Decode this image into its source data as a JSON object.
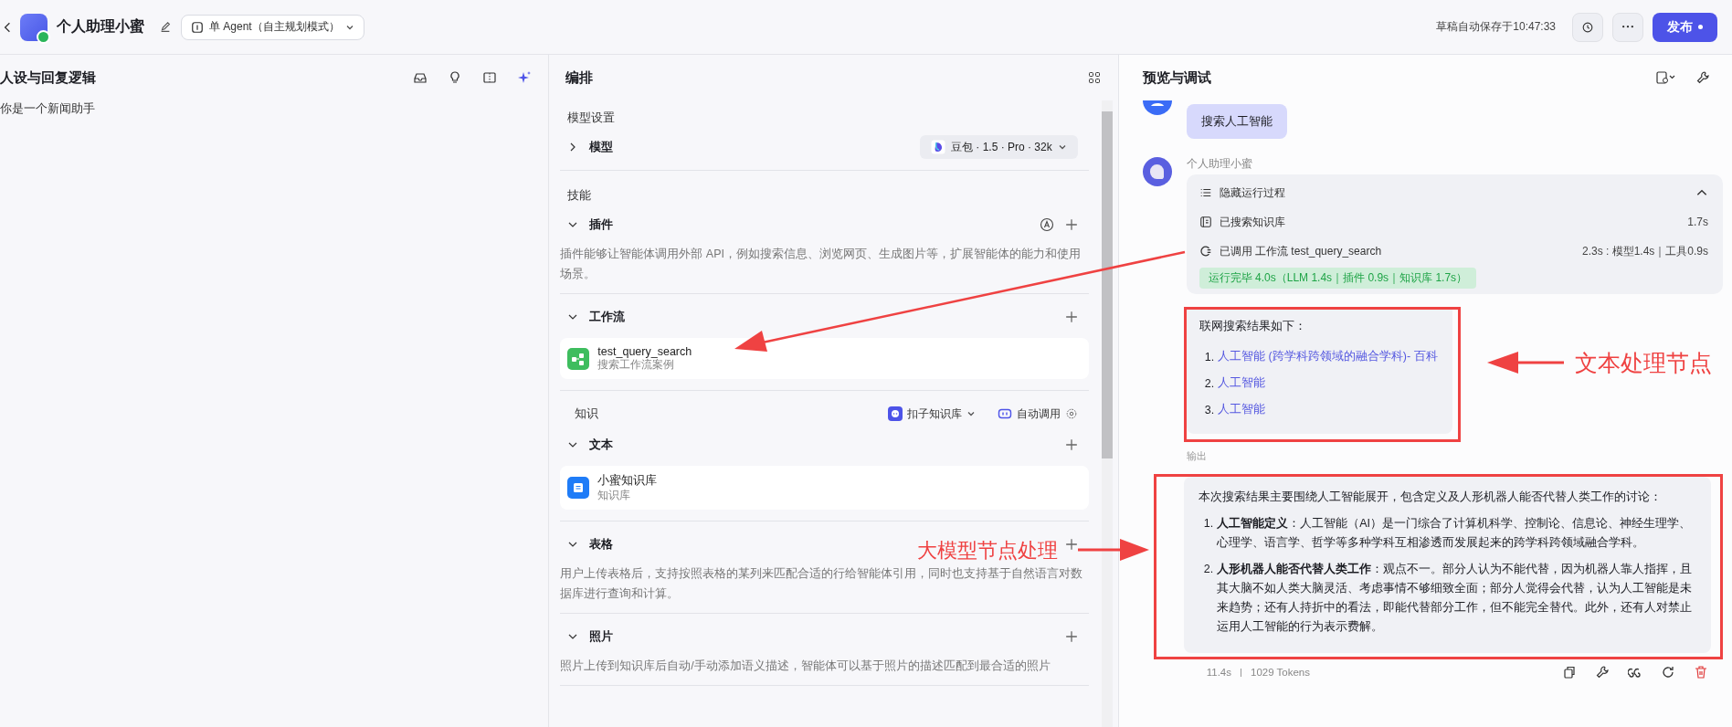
{
  "header": {
    "agent_name": "个人助理小蜜",
    "mode": "单 Agent（自主规划模式）",
    "autosave": "草稿自动保存于10:47:33",
    "publish": "发布"
  },
  "persona": {
    "title": "人设与回复逻辑",
    "prompt": "你是一个新闻助手"
  },
  "arrange": {
    "title": "编排",
    "model_settings": {
      "heading": "模型设置",
      "label": "模型",
      "expanded": false,
      "model": "豆包 · 1.5 · Pro · 32k"
    },
    "skills": {
      "heading": "技能",
      "items": [
        {
          "kind": "plugin",
          "label": "插件",
          "expanded": true,
          "description": "插件能够让智能体调用外部 API，例如搜索信息、浏览网页、生成图片等，扩展智能体的能力和使用场景。"
        },
        {
          "kind": "workflow",
          "label": "工作流",
          "expanded": true,
          "cards": [
            {
              "kind": "workflow",
              "title": "test_query_search",
              "subtitle": "搜索工作流案例"
            }
          ]
        }
      ]
    },
    "knowledge": {
      "heading": "知识",
      "source": "扣子知识库",
      "call_mode": "自动调用",
      "items": [
        {
          "label": "文本",
          "expanded": true,
          "cards": [
            {
              "kind": "knowledge",
              "title": "小蜜知识库",
              "subtitle": "知识库"
            }
          ]
        },
        {
          "label": "表格",
          "expanded": true,
          "description": "用户上传表格后，支持按照表格的某列来匹配合适的行给智能体引用，同时也支持基于自然语言对数据库进行查询和计算。"
        },
        {
          "label": "照片",
          "expanded": true,
          "description": "照片上传到知识库后自动/手动添加语义描述，智能体可以基于照片的描述匹配到最合适的照片"
        }
      ]
    }
  },
  "preview": {
    "title": "预览与调试",
    "user_message": "搜索人工智能",
    "bot_name": "个人助理小蜜",
    "process": {
      "toggle": "隐藏运行过程",
      "expanded": true,
      "steps": [
        {
          "kind": "knowledge",
          "label": "已搜索知识库",
          "time": "1.7s"
        },
        {
          "kind": "workflow",
          "label": "已调用 工作流 test_query_search",
          "time": "2.3s : 模型1.4s｜工具0.9s"
        }
      ],
      "summary": "运行完毕 4.0s（LLM 1.4s｜插件 0.9s｜知识库 1.7s）"
    },
    "result": {
      "intro": "联网搜索结果如下：",
      "links": [
        {
          "number": "1.",
          "text": "人工智能 (跨学科跨领域的融合学科)- 百科"
        },
        {
          "number": "2.",
          "text": "人工智能"
        },
        {
          "number": "3.",
          "text": "人工智能"
        }
      ]
    },
    "output_label": "输出",
    "answer": {
      "intro": "本次搜索结果主要围绕人工智能展开，包含定义及人形机器人能否代替人类工作的讨论：",
      "items": [
        {
          "number": "1.",
          "text": "**人工智能定义**：人工智能（AI）是一门综合了计算机科学、控制论、信息论、神经生理学、心理学、语言学、哲学等多种学科互相渗透而发展起来的跨学科跨领域融合学科。"
        },
        {
          "number": "2.",
          "text": "**人形机器人能否代替人类工作**：观点不一。部分人认为不能代替，因为机器人靠人指挥，且其大脑不如人类大脑灵活、考虑事情不够细致全面；部分人觉得会代替，认为人工智能是未来趋势；还有人持折中的看法，即能代替部分工作，但不能完全替代。此外，还有人对禁止运用人工智能的行为表示费解。"
        }
      ]
    },
    "duration": "11.4s",
    "tokens": "1029 Tokens"
  },
  "annotations": [
    {
      "kind": "text_node",
      "label": "文本处理节点"
    },
    {
      "kind": "llm_node",
      "label": "大模型节点处理"
    }
  ]
}
